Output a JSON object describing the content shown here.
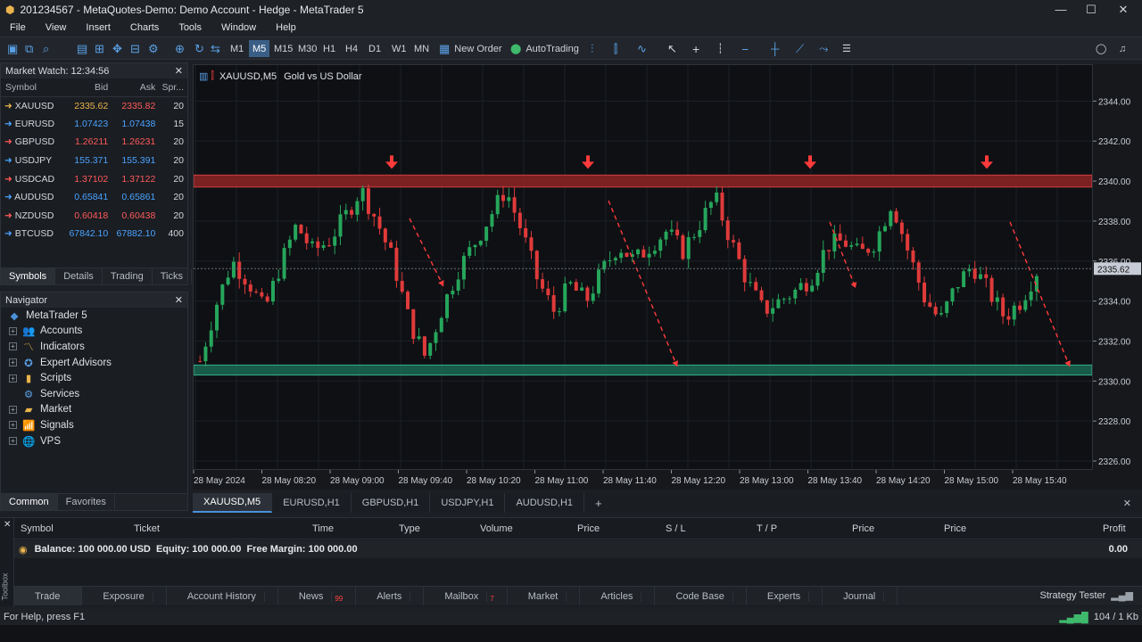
{
  "window": {
    "title": "201234567 - MetaQuotes-Demo: Demo Account - Hedge - MetaTrader 5"
  },
  "menu": [
    "File",
    "View",
    "Insert",
    "Charts",
    "Tools",
    "Window",
    "Help"
  ],
  "toolbar": {
    "timeframes": [
      "M1",
      "M5",
      "M15",
      "M30",
      "H1",
      "H4",
      "D1",
      "W1",
      "MN"
    ],
    "active_tf": "M5",
    "new_order": "New Order",
    "autotrading": "AutoTrading"
  },
  "market_watch": {
    "title": "Market Watch: 12:34:56",
    "headers": [
      "Symbol",
      "Bid",
      "Ask",
      "Spr..."
    ],
    "rows": [
      {
        "symbol": "XAUUSD",
        "bid": "2335.62",
        "ask": "2335.82",
        "spread": "20"
      },
      {
        "symbol": "EURUSD",
        "bid": "1.07423",
        "ask": "1.07438",
        "spread": "15"
      },
      {
        "symbol": "GBPUSD",
        "bid": "1.26211",
        "ask": "1.26231",
        "spread": "20"
      },
      {
        "symbol": "USDJPY",
        "bid": "155.371",
        "ask": "155.391",
        "spread": "20"
      },
      {
        "symbol": "USDCAD",
        "bid": "1.37102",
        "ask": "1.37122",
        "spread": "20"
      },
      {
        "symbol": "AUDUSD",
        "bid": "0.65841",
        "ask": "0.65861",
        "spread": "20"
      },
      {
        "symbol": "NZDUSD",
        "bid": "0.60418",
        "ask": "0.60438",
        "spread": "20"
      },
      {
        "symbol": "BTCUSD",
        "bid": "67842.10",
        "ask": "67882.10",
        "spread": "400"
      }
    ],
    "tabs": [
      "Symbols",
      "Details",
      "Trading",
      "Ticks"
    ]
  },
  "navigator": {
    "title": "Navigator",
    "root": "MetaTrader 5",
    "items": [
      "Accounts",
      "Indicators",
      "Expert Advisors",
      "Scripts",
      "Services",
      "Market",
      "Signals",
      "VPS"
    ],
    "tabs": [
      "Common",
      "Favorites"
    ]
  },
  "chart": {
    "header": "XAUUSD,M5",
    "desc": "Gold vs US Dollar",
    "current_price": "2335.62",
    "price_ticks": [
      "2344.00",
      "2342.00",
      "2340.00",
      "2338.00",
      "2336.00",
      "2334.00",
      "2332.00",
      "2330.00",
      "2328.00",
      "2326.00"
    ],
    "time_ticks": [
      "28 May 2024",
      "28 May 08:20",
      "28 May 09:00",
      "28 May 09:40",
      "28 May 10:20",
      "28 May 11:00",
      "28 May 11:40",
      "28 May 12:20",
      "28 May 13:00",
      "28 May 13:40",
      "28 May 14:20",
      "28 May 15:00",
      "28 May 15:40"
    ]
  },
  "chart_data": {
    "type": "candlestick",
    "ylim": [
      2325.6,
      2345.8
    ],
    "resistance": [
      2339.7,
      2340.3
    ],
    "support": [
      2330.3,
      2330.8
    ],
    "current_price": 2335.62,
    "close_path": [
      2331.0,
      2333.8,
      2336.0,
      2335.0,
      2333.5,
      2335.8,
      2337.8,
      2336.5,
      2337.0,
      2338.2,
      2339.6,
      2338.0,
      2336.0,
      2333.0,
      2331.2,
      2333.5,
      2335.5,
      2336.8,
      2338.2,
      2339.6,
      2337.5,
      2335.0,
      2333.5,
      2334.8,
      2334.0,
      2335.5,
      2336.8,
      2336.0,
      2336.8,
      2337.5,
      2336.5,
      2337.8,
      2339.2,
      2337.0,
      2335.0,
      2333.5,
      2334.0,
      2334.5,
      2335.2,
      2336.8,
      2337.0,
      2336.3,
      2337.0,
      2339.0,
      2336.5,
      2334.2,
      2333.0,
      2334.8,
      2335.8,
      2334.5,
      2333.2,
      2334.0,
      2335.5
    ],
    "arrows": [
      {
        "x": "28 May 09:15",
        "y": 2340.3
      },
      {
        "x": "28 May 11:05",
        "y": 2340.3
      },
      {
        "x": "28 May 13:20",
        "y": 2340.3
      },
      {
        "x": "28 May 15:10",
        "y": 2340.3
      }
    ]
  },
  "chart_tabs": [
    "XAUUSD,M5",
    "EURUSD,H1",
    "GBPUSD,H1",
    "USDJPY,H1",
    "AUDUSD,H1"
  ],
  "toolbox": {
    "headers": [
      "Symbol",
      "Ticket",
      "Time",
      "Type",
      "Volume",
      "Price",
      "S / L",
      "T / P",
      "Price",
      "Price",
      "Profit"
    ],
    "balance": "Balance: 100 000.00 USD  Equity: 100 000.00  Free Margin: 100 000.00",
    "profit": "0.00",
    "side_label": "Toolbox",
    "tabs": [
      {
        "label": "Trade",
        "badge": ""
      },
      {
        "label": "Exposure",
        "badge": ""
      },
      {
        "label": "Account History",
        "badge": ""
      },
      {
        "label": "News",
        "badge": "99"
      },
      {
        "label": "Alerts",
        "badge": ""
      },
      {
        "label": "Mailbox",
        "badge": "7"
      },
      {
        "label": "Market",
        "badge": ""
      },
      {
        "label": "Articles",
        "badge": ""
      },
      {
        "label": "Code Base",
        "badge": ""
      },
      {
        "label": "Experts",
        "badge": ""
      },
      {
        "label": "Journal",
        "badge": ""
      }
    ],
    "strategy_tester": "Strategy Tester"
  },
  "status": {
    "help": "For Help, press F1",
    "traffic": "104 / 1 Kb"
  },
  "colors": {
    "bull": "#26a65b",
    "bear": "#e03a3a",
    "resistance": "#b83232",
    "support": "#1f8f6a",
    "accent": "#3a5f86"
  }
}
